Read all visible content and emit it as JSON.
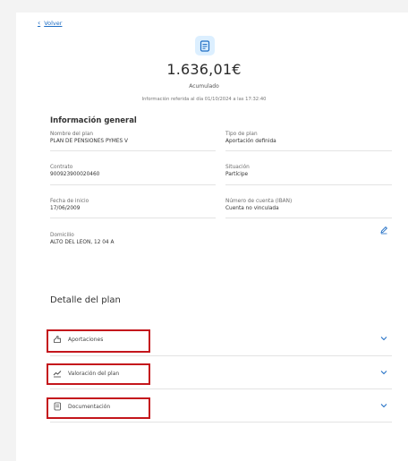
{
  "nav": {
    "back_label": "Volver"
  },
  "summary": {
    "amount": "1.636,01€",
    "amount_label": "Acumulado",
    "info_date": "Información referida al día 01/10/2024 a las 17:32:40"
  },
  "general": {
    "title": "Información general",
    "fields": [
      {
        "label": "Nombre del plan",
        "value": "PLAN DE PENSIONES PYMES V"
      },
      {
        "label": "Tipo de plan",
        "value": "Aportación definida"
      },
      {
        "label": "Contrato",
        "value": "900923900020460"
      },
      {
        "label": "Situación",
        "value": "Partícipe"
      },
      {
        "label": "Fecha de inicio",
        "value": "17/06/2009"
      },
      {
        "label": "Número de cuenta (IBAN)",
        "value": "Cuenta no vinculada"
      },
      {
        "label": "Domicilio",
        "value": "ALTO DEL LEON, 12 04 A"
      }
    ]
  },
  "detail": {
    "title": "Detalle del plan",
    "items": [
      {
        "label": "Aportaciones",
        "icon": "hand-coins-icon"
      },
      {
        "label": "Valoración del plan",
        "icon": "chart-line-icon"
      },
      {
        "label": "Documentación",
        "icon": "document-icon"
      }
    ]
  },
  "colors": {
    "accent": "#1e6dc4",
    "highlight": "#c4161c",
    "icon_bg": "#dcefff"
  }
}
